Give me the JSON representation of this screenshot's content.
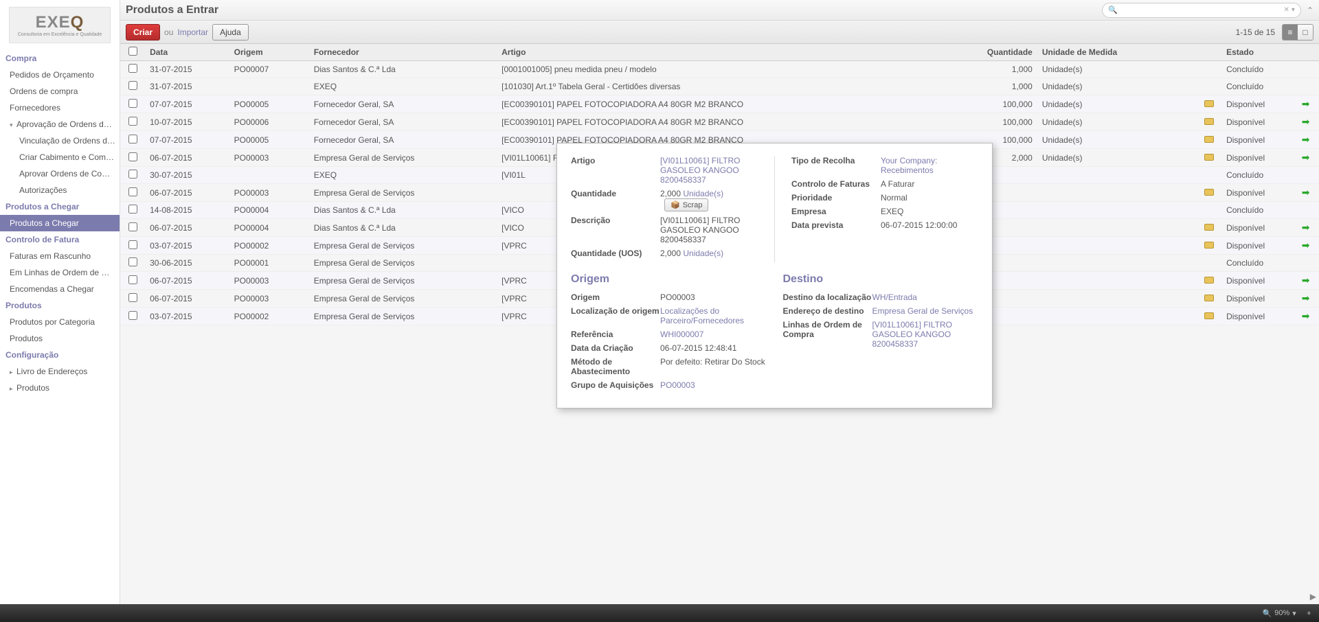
{
  "logo": {
    "main": "EXE",
    "accent": "Q",
    "sub": "Consultoria em Excelência e Qualidade"
  },
  "nav": {
    "compra": "Compra",
    "compra_items": [
      "Pedidos de Orçamento",
      "Ordens de compra",
      "Fornecedores"
    ],
    "aprov": "Aprovação de Ordens de Co...",
    "aprov_items": [
      "Vinculação de Ordens de...",
      "Criar Cabimento e Compr...",
      "Aprovar Ordens de Compra",
      "Autorizações"
    ],
    "chegar": "Produtos a Chegar",
    "chegar_items": [
      "Produtos a Chegar"
    ],
    "ctrl": "Controlo de Fatura",
    "ctrl_items": [
      "Faturas em Rascunho",
      "Em Linhas de Ordem de Co...",
      "Encomendas a Chegar"
    ],
    "prod": "Produtos",
    "prod_items": [
      "Produtos por Categoria",
      "Produtos"
    ],
    "conf": "Configuração",
    "conf_items": [
      "Livro de Endereços",
      "Produtos"
    ]
  },
  "header": {
    "title": "Produtos a Entrar"
  },
  "toolbar": {
    "create": "Criar",
    "or": "ou",
    "import": "Importar",
    "help": "Ajuda",
    "pager": "1-15 de 15"
  },
  "thead": {
    "date": "Data",
    "origin": "Origem",
    "supplier": "Fornecedor",
    "article": "Artigo",
    "qty": "Quantidade",
    "uom": "Unidade de Medida",
    "state": "Estado"
  },
  "rows": [
    {
      "date": "31-07-2015",
      "po": "PO00007",
      "sup": "Dias Santos & C.ª Lda",
      "art": "[0001001005] pneu medida pneu / modelo",
      "qty": "1,000",
      "uom": "Unidade(s)",
      "pkg": false,
      "st": "Concluído",
      "arr": false
    },
    {
      "date": "31-07-2015",
      "po": "",
      "sup": "EXEQ",
      "art": "[101030] Art.1º Tabela Geral - Certidões diversas",
      "qty": "1,000",
      "uom": "Unidade(s)",
      "pkg": false,
      "st": "Concluído",
      "arr": false
    },
    {
      "date": "07-07-2015",
      "po": "PO00005",
      "sup": "Fornecedor Geral, SA",
      "art": "[EC00390101] PAPEL FOTOCOPIADORA A4 80GR M2 BRANCO",
      "qty": "100,000",
      "uom": "Unidade(s)",
      "pkg": true,
      "st": "Disponível",
      "arr": true
    },
    {
      "date": "10-07-2015",
      "po": "PO00006",
      "sup": "Fornecedor Geral, SA",
      "art": "[EC00390101] PAPEL FOTOCOPIADORA A4 80GR M2 BRANCO",
      "qty": "100,000",
      "uom": "Unidade(s)",
      "pkg": true,
      "st": "Disponível",
      "arr": true
    },
    {
      "date": "07-07-2015",
      "po": "PO00005",
      "sup": "Fornecedor Geral, SA",
      "art": "[EC00390101] PAPEL FOTOCOPIADORA A4 80GR M2 BRANCO",
      "qty": "100,000",
      "uom": "Unidade(s)",
      "pkg": true,
      "st": "Disponível",
      "arr": true
    },
    {
      "date": "06-07-2015",
      "po": "PO00003",
      "sup": "Empresa Geral de Serviços",
      "art": "[VI01L10061] FILTRO GASOLEO KANGOO 8200458337",
      "qty": "2,000",
      "uom": "Unidade(s)",
      "pkg": true,
      "st": "Disponível",
      "arr": true
    },
    {
      "date": "30-07-2015",
      "po": "",
      "sup": "EXEQ",
      "art": "[VI01L",
      "qty": "",
      "uom": "",
      "pkg": false,
      "st": "Concluído",
      "arr": false
    },
    {
      "date": "06-07-2015",
      "po": "PO00003",
      "sup": "Empresa Geral de Serviços",
      "art": "",
      "qty": "",
      "uom": "",
      "pkg": true,
      "st": "Disponível",
      "arr": true
    },
    {
      "date": "14-08-2015",
      "po": "PO00004",
      "sup": "Dias Santos & C.ª Lda",
      "art": "[VICO",
      "qty": "",
      "uom": "",
      "pkg": false,
      "st": "Concluído",
      "arr": false
    },
    {
      "date": "06-07-2015",
      "po": "PO00004",
      "sup": "Dias Santos & C.ª Lda",
      "art": "[VICO",
      "qty": "",
      "uom": "",
      "pkg": true,
      "st": "Disponível",
      "arr": true
    },
    {
      "date": "03-07-2015",
      "po": "PO00002",
      "sup": "Empresa Geral de Serviços",
      "art": "[VPRC",
      "qty": "",
      "uom": "",
      "pkg": true,
      "st": "Disponível",
      "arr": true
    },
    {
      "date": "30-06-2015",
      "po": "PO00001",
      "sup": "Empresa Geral de Serviços",
      "art": "",
      "qty": "",
      "uom": "",
      "pkg": false,
      "st": "Concluído",
      "arr": false
    },
    {
      "date": "06-07-2015",
      "po": "PO00003",
      "sup": "Empresa Geral de Serviços",
      "art": "[VPRC",
      "qty": "",
      "uom": "",
      "pkg": true,
      "st": "Disponível",
      "arr": true
    },
    {
      "date": "06-07-2015",
      "po": "PO00003",
      "sup": "Empresa Geral de Serviços",
      "art": "[VPRC",
      "qty": "",
      "uom": "",
      "pkg": true,
      "st": "Disponível",
      "arr": true
    },
    {
      "date": "03-07-2015",
      "po": "PO00002",
      "sup": "Empresa Geral de Serviços",
      "art": "[VPRC",
      "qty": "",
      "uom": "",
      "pkg": true,
      "st": "Disponível",
      "arr": true
    }
  ],
  "popup": {
    "left": {
      "article_l": "Artigo",
      "article_v": "[VI01L10061] FILTRO GASOLEO KANGOO 8200458337",
      "qty_l": "Quantidade",
      "qty_v": "2,000",
      "qty_u": "Unidade(s)",
      "scrap": "Scrap",
      "desc_l": "Descrição",
      "desc_v": "[VI01L10061] FILTRO GASOLEO KANGOO 8200458337",
      "uos_l": "Quantidade (UOS)",
      "uos_v": "2,000",
      "uos_u": "Unidade(s)"
    },
    "right": {
      "tipo_l": "Tipo de Recolha",
      "tipo_v": "Your Company: Recebimentos",
      "fat_l": "Controlo de Faturas",
      "fat_v": "A Faturar",
      "pri_l": "Prioridade",
      "pri_v": "Normal",
      "emp_l": "Empresa",
      "emp_v": "EXEQ",
      "data_l": "Data prevista",
      "data_v": "06-07-2015 12:00:00"
    },
    "origem_title": "Origem",
    "destino_title": "Destino",
    "origem": {
      "o_l": "Origem",
      "o_v": "PO00003",
      "loc_l": "Localização de origem",
      "loc_v": "Localizações do Parceiro/Fornecedores",
      "ref_l": "Referência",
      "ref_v": "WHI000007",
      "cri_l": "Data da Criação",
      "cri_v": "06-07-2015 12:48:41",
      "met_l": "Método de Abastecimento",
      "met_v": "Por defeito: Retirar Do Stock",
      "grp_l": "Grupo de Aquisições",
      "grp_v": "PO00003"
    },
    "destino": {
      "dl_l": "Destino da localização",
      "dl_v": "WH/Entrada",
      "ed_l": "Endereço de destino",
      "ed_v": "Empresa Geral de Serviços",
      "loc_l": "Linhas de Ordem de Compra",
      "loc_v": "[VI01L10061] FILTRO GASOLEO KANGOO 8200458337"
    }
  },
  "status": {
    "zoom": "90%"
  }
}
